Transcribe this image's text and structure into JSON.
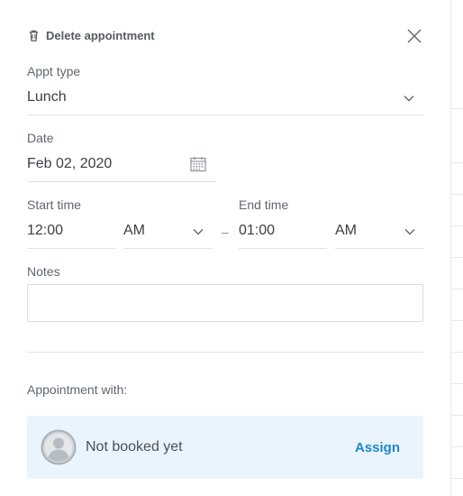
{
  "header": {
    "delete_label": "Delete appointment"
  },
  "appt_type": {
    "label": "Appt type",
    "value": "Lunch"
  },
  "date": {
    "label": "Date",
    "value": "Feb 02, 2020"
  },
  "start_time": {
    "label": "Start time",
    "time": "12:00",
    "meridiem": "AM"
  },
  "separator": "–",
  "end_time": {
    "label": "End time",
    "time": "01:00",
    "meridiem": "AM"
  },
  "notes": {
    "label": "Notes",
    "value": ""
  },
  "appointment_with": {
    "label": "Appointment with:",
    "status": "Not booked yet",
    "assign_label": "Assign"
  },
  "colors": {
    "accent": "#1f86cf",
    "card_bg": "#e9f4fc"
  }
}
